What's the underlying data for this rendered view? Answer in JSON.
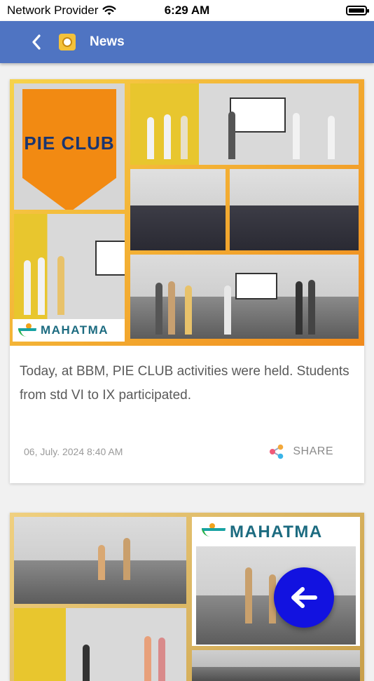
{
  "status_bar": {
    "carrier": "Network Provider",
    "time": "6:29 AM",
    "wifi_icon": "wifi-icon",
    "battery_icon": "battery-icon"
  },
  "header": {
    "title": "News",
    "back_icon": "chevron-left-icon",
    "logo_icon": "school-logo-icon",
    "color": "#4f74c2"
  },
  "news": [
    {
      "image_banner_text": "PIE CLUB",
      "brand_text": "MAHATMA",
      "description": "Today, at BBM, PIE CLUB activities were held. Students from std VI to IX participated.",
      "date": "06, July. 2024 8:40 AM",
      "share_label": "SHARE",
      "share_icon": "share-icon"
    },
    {
      "brand_text": "MAHATMA"
    }
  ],
  "fab": {
    "icon": "arrow-left-icon",
    "color": "#1212e0"
  }
}
